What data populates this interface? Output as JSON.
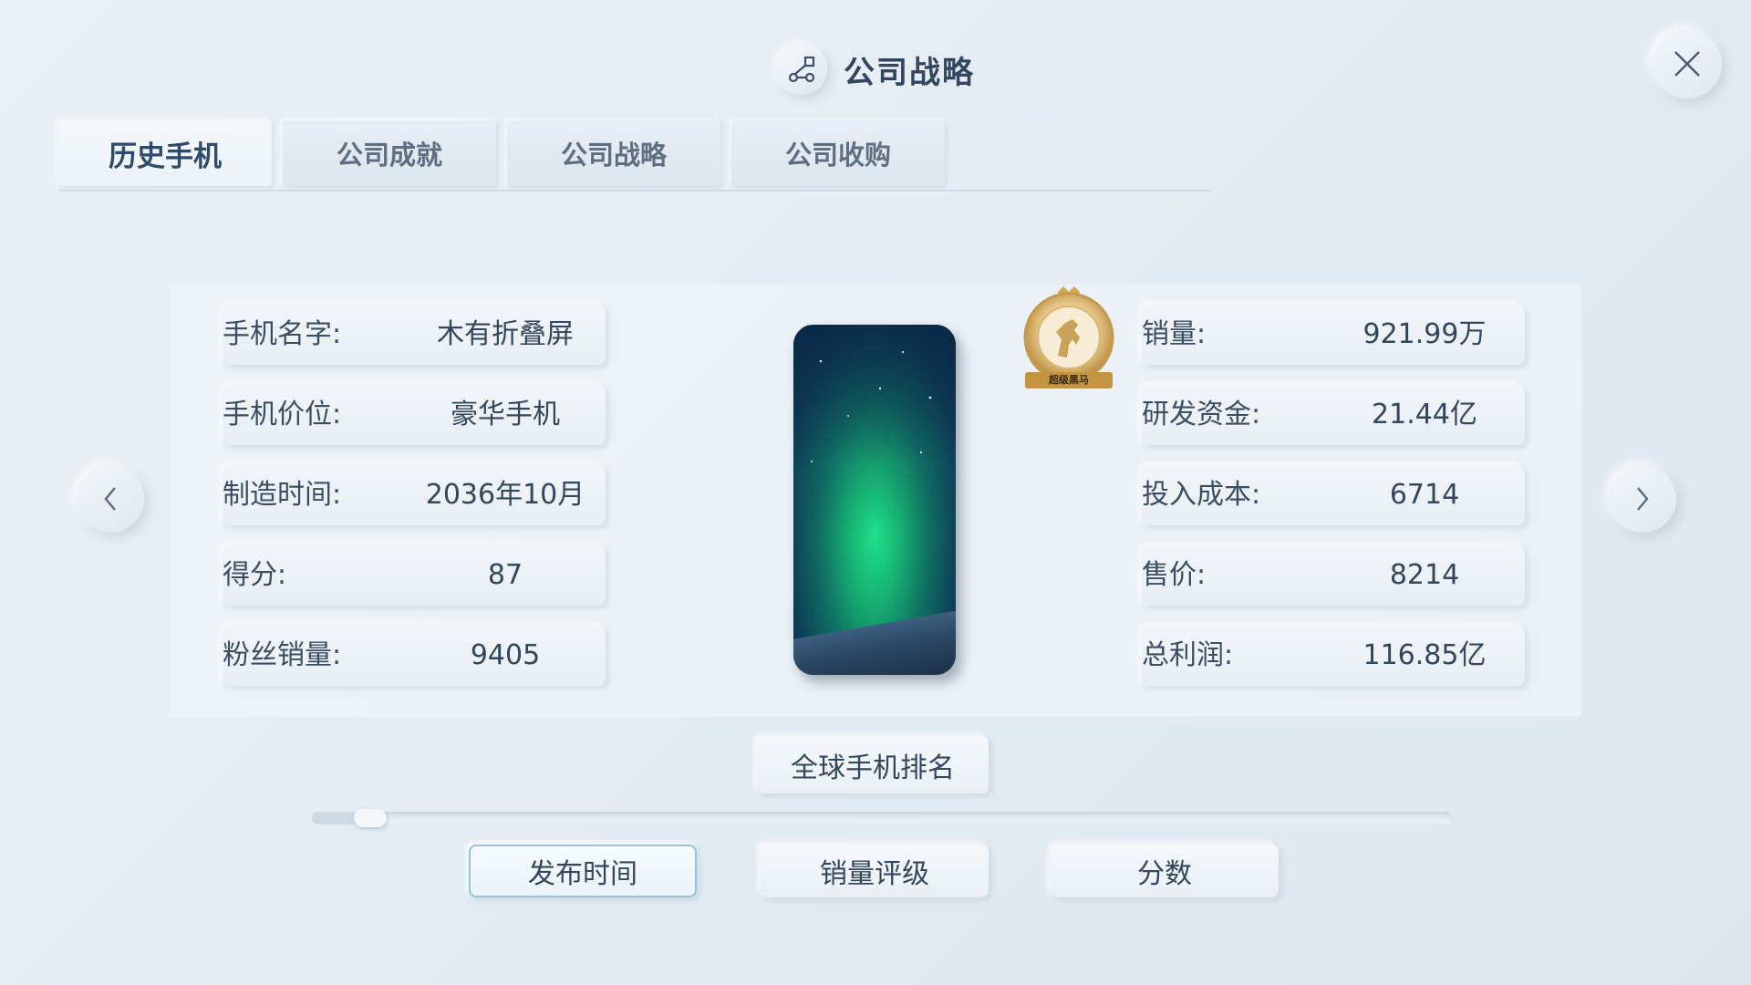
{
  "window": {
    "title": "公司战略",
    "title_icon": "strategy-nodes-icon",
    "close_icon": "close-icon"
  },
  "tabs": [
    {
      "label": "历史手机",
      "active": true
    },
    {
      "label": "公司成就",
      "active": false
    },
    {
      "label": "公司战略",
      "active": false
    },
    {
      "label": "公司收购",
      "active": false
    }
  ],
  "phone_info": {
    "left": [
      {
        "label": "手机名字:",
        "value": "木有折叠屏"
      },
      {
        "label": "手机价位:",
        "value": "豪华手机"
      },
      {
        "label": "制造时间:",
        "value": "2036年10月"
      },
      {
        "label": "得分:",
        "value": "87"
      },
      {
        "label": "粉丝销量:",
        "value": "9405"
      }
    ],
    "right": [
      {
        "label": "销量:",
        "value": "921.99万"
      },
      {
        "label": "研发资金:",
        "value": "21.44亿"
      },
      {
        "label": "投入成本:",
        "value": "6714"
      },
      {
        "label": "售价:",
        "value": "8214"
      },
      {
        "label": "总利润:",
        "value": "116.85亿"
      }
    ],
    "badge_text": "超级黑马",
    "badge_icon": "horse-medal-icon",
    "phone_image": "aurora-phone"
  },
  "nav": {
    "prev_icon": "chevron-left-icon",
    "next_icon": "chevron-right-icon"
  },
  "ranking_button": "全球手机排名",
  "slider": {
    "position": 0.03
  },
  "sort_buttons": [
    {
      "label": "发布时间",
      "selected": true
    },
    {
      "label": "销量评级",
      "selected": false
    },
    {
      "label": "分数",
      "selected": false
    }
  ],
  "colors": {
    "background": "#e5ecf2",
    "text": "#34465c",
    "selected_border": "#8fc6df"
  }
}
